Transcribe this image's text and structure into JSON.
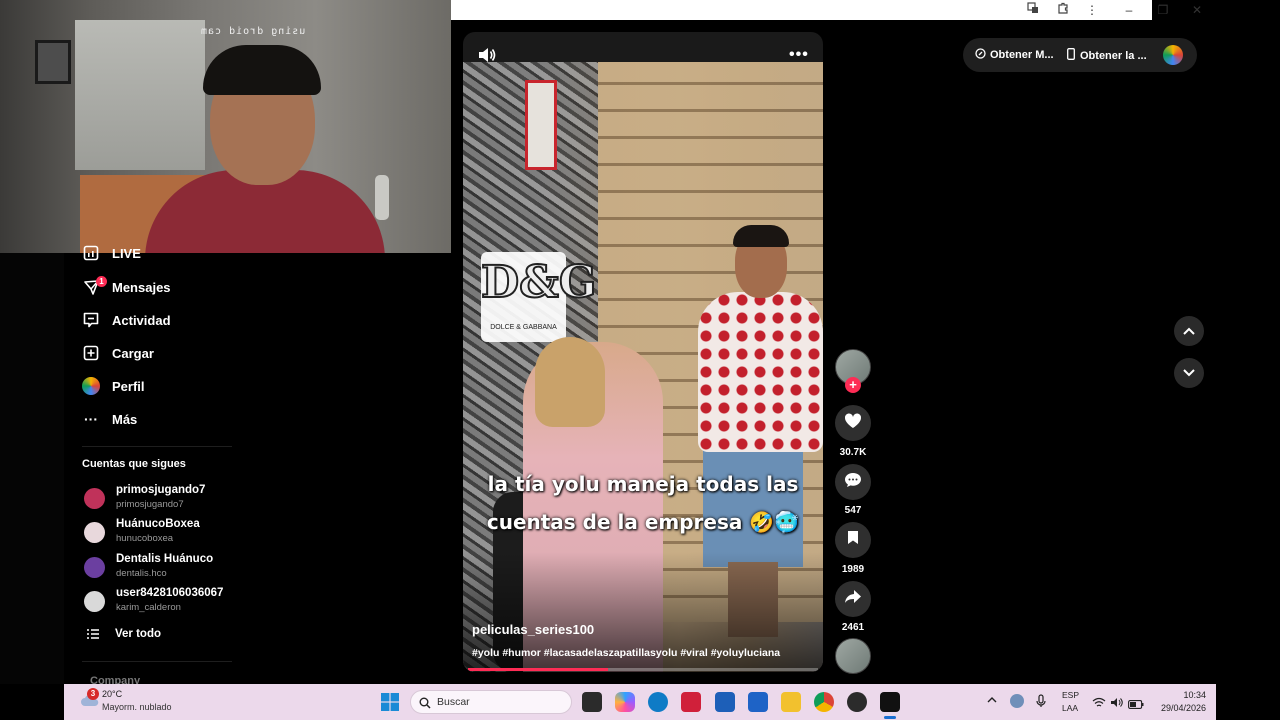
{
  "webcam": {
    "mirrored_text": "using droid cam"
  },
  "sidebar": {
    "items": [
      {
        "label": "LIVE",
        "icon": "live-icon"
      },
      {
        "label": "Mensajes",
        "icon": "messages-icon",
        "badge": "1"
      },
      {
        "label": "Actividad",
        "icon": "activity-icon"
      },
      {
        "label": "Cargar",
        "icon": "upload-icon"
      },
      {
        "label": "Perfil",
        "icon": "profile-avatar-icon"
      },
      {
        "label": "Más",
        "icon": "more-dots-icon"
      }
    ],
    "following_title": "Cuentas que sigues",
    "following": [
      {
        "name": "primosjugando7",
        "handle": "primosjugando7",
        "color": "#c0325a"
      },
      {
        "name": "HuánucoBoxea",
        "handle": "hunucoboxea",
        "color": "#e8d8dc"
      },
      {
        "name": "Dentalis Huánuco",
        "handle": "dentalis.hco",
        "color": "#6b3fa0"
      },
      {
        "name": "user8428106036067",
        "handle": "karim_calderon",
        "color": "#d9d9d9"
      }
    ],
    "see_all": "Ver todo",
    "footer_partial": "Company"
  },
  "video": {
    "brand_text": "D&G",
    "brand_sub": "DOLCE & GABBANA",
    "caption_line1": "la tía yolu maneja todas las",
    "caption_line2": "cuentas de la empresa 🤣🥶",
    "author": "peliculas_series100",
    "hashtags": "#yolu #humor #lacasadelaszapatillasyolu #viral #yoluyluciana",
    "progress": 0.4
  },
  "actions": {
    "likes": "30.7K",
    "comments": "547",
    "saves": "1989",
    "shares": "2461"
  },
  "top_pill": {
    "item1": "Obtener M...",
    "item2": "Obtener la ..."
  },
  "taskbar": {
    "weather_temp": "20°C",
    "weather_desc": "Mayorm. nublado",
    "weather_badge": "3",
    "search_placeholder": "Buscar",
    "lang_top": "ESP",
    "lang_bottom": "LAA",
    "time": "10:34",
    "date": "29/04/2026"
  },
  "colors": {
    "accent": "#fe2c55",
    "taskbar_bg": "#ecd9eb"
  }
}
